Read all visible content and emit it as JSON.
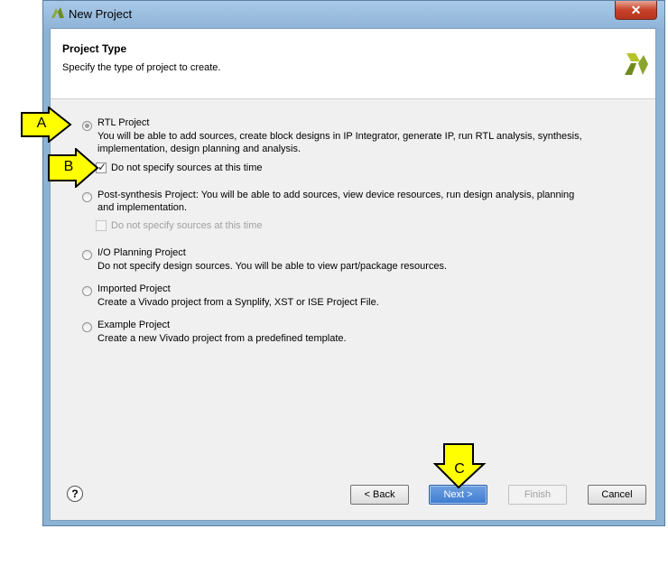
{
  "window": {
    "title": "New Project",
    "close_label": "✕"
  },
  "header": {
    "title": "Project Type",
    "subtitle": "Specify the type of project to create."
  },
  "options": [
    {
      "title": "RTL Project",
      "desc": "You will be able to add sources, create block designs in IP Integrator, generate IP, run RTL analysis, synthesis, implementation, design planning and analysis.",
      "selected": true
    },
    {
      "title": "Post-synthesis Project",
      "desc": "Post-synthesis Project: You will be able to add sources, view device resources, run design analysis, planning and implementation.",
      "selected": false
    },
    {
      "title": "I/O Planning Project",
      "desc": "Do not specify design sources. You will be able to view part/package resources.",
      "selected": false
    },
    {
      "title": "Imported Project",
      "desc": "Create a Vivado project from a Synplify, XST or ISE Project File.",
      "selected": false
    },
    {
      "title": "Example Project",
      "desc": "Create a new Vivado project from a predefined template.",
      "selected": false
    }
  ],
  "checkboxes": {
    "rtl_no_sources": {
      "label": "Do not specify sources at this time",
      "checked": true,
      "enabled": true
    },
    "post_synth_no_sources": {
      "label": "Do not specify sources at this time",
      "checked": false,
      "enabled": false
    }
  },
  "footer": {
    "help": "?",
    "back": "< Back",
    "next": "Next >",
    "finish": "Finish",
    "cancel": "Cancel"
  },
  "callouts": {
    "a": "A",
    "b": "B",
    "c": "C"
  },
  "colors": {
    "callout_fill": "#ffff00",
    "primary_button": "#3d7bd1",
    "title_bar": "#8fb4d8"
  }
}
